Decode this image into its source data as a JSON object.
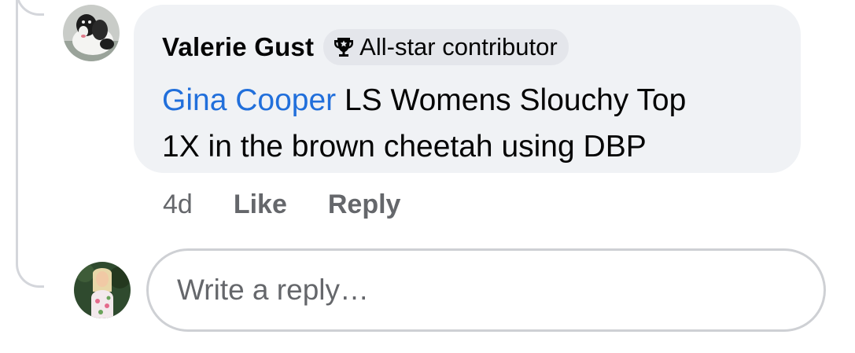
{
  "comment": {
    "author": "Valerie Gust",
    "badge": {
      "icon": "trophy-icon",
      "label": "All-star contributor"
    },
    "mention": "Gina Cooper",
    "text_line1": " LS Womens Slouchy Top",
    "text_line2": "1X in the brown cheetah using DBP",
    "timestamp": "4d",
    "like_label": "Like",
    "reply_label": "Reply",
    "avatar": "dog-avatar"
  },
  "reply_box": {
    "placeholder": "Write a reply…",
    "avatar": "user-avatar"
  },
  "colors": {
    "bubble_bg": "#f0f2f5",
    "badge_bg": "#e4e6eb",
    "mention": "#216fdb",
    "secondary_text": "#65676b",
    "primary_text": "#050505",
    "thread_line": "#d4d6db"
  }
}
